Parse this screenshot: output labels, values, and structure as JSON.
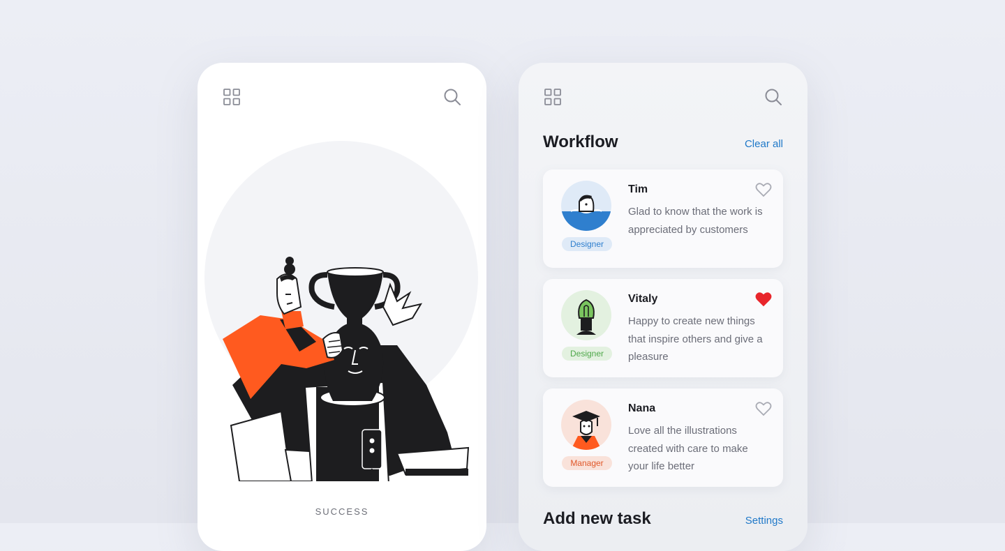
{
  "left_screen": {
    "caption": "SUCCESS",
    "icons": {
      "menu": "grid-icon",
      "search": "search-icon"
    }
  },
  "workflow": {
    "title": "Workflow",
    "clear_all": "Clear all",
    "cards": [
      {
        "name": "Tim",
        "message": "Glad to know that the work is appreciated by customers",
        "role": "Designer",
        "liked": false,
        "role_color": "#2f7fce",
        "role_bg": "#dfeaf7"
      },
      {
        "name": "Vitaly",
        "message": "Happy to create new things that inspire others and give a pleasure",
        "role": "Designer",
        "liked": true,
        "role_color": "#4fa84a",
        "role_bg": "#e3f1e0"
      },
      {
        "name": "Nana",
        "message": "Love all the illustrations created with care to make your life better",
        "role": "Manager",
        "liked": false,
        "role_color": "#e0582a",
        "role_bg": "#f9e2da"
      }
    ],
    "add_task": "Add new task",
    "settings": "Settings"
  },
  "colors": {
    "accent": "#1f78c8",
    "orange": "#ff5a1f",
    "heart_active": "#e8252b"
  }
}
